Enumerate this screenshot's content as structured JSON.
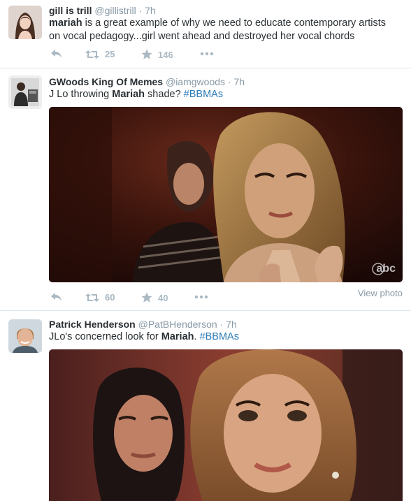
{
  "tweets": [
    {
      "name": "gill is trill",
      "handle": "@gillistrill",
      "time": "7h",
      "text_parts": [
        {
          "text": "mariah",
          "bold": true
        },
        {
          "text": " is a great example of why we need to educate contemporary artists on vocal pedagogy...girl went ahead and destroyed her vocal chords"
        }
      ],
      "retweets": "25",
      "likes": "146"
    },
    {
      "name": "GWoods King Of Memes",
      "handle": "@iamgwoods",
      "time": "7h",
      "text_parts": [
        {
          "text": "J Lo throwing "
        },
        {
          "text": "Mariah",
          "bold": true
        },
        {
          "text": " shade? "
        },
        {
          "text": "#BBMAs",
          "hashtag": true
        }
      ],
      "retweets": "60",
      "likes": "40",
      "view_photo": "View photo",
      "watermark": "abc"
    },
    {
      "name": "Patrick Henderson",
      "handle": "@PatBHenderson",
      "time": "7h",
      "text_parts": [
        {
          "text": "JLo's concerned look for "
        },
        {
          "text": "Mariah",
          "bold": true
        },
        {
          "text": ". "
        },
        {
          "text": "#BBMAs",
          "hashtag": true
        }
      ]
    }
  ],
  "ui": {
    "separator": "·"
  },
  "colors": {
    "link": "#2b7bb9",
    "muted": "#8899a6",
    "action": "#aab8c2",
    "divider": "#e1e8ed"
  }
}
